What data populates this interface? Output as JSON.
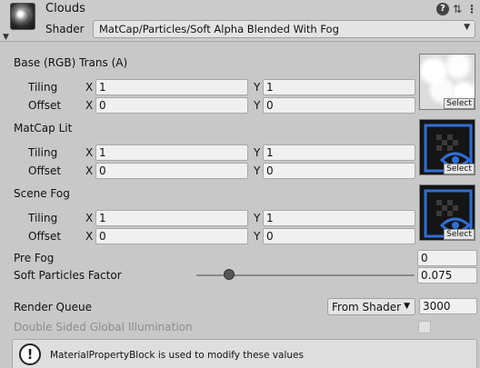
{
  "header": {
    "title": "Clouds",
    "shader_label": "Shader",
    "shader_value": "MatCap/Particles/Soft Alpha Blended With Fog",
    "icons": [
      "help-icon",
      "presets-icon",
      "more-icon"
    ]
  },
  "sections": [
    {
      "title": "Base (RGB) Trans (A)",
      "tiling_label": "Tiling",
      "offset_label": "Offset",
      "tiling_x": "1",
      "tiling_y": "1",
      "offset_x": "0",
      "offset_y": "0",
      "texture": "clouds",
      "select_label": "Select"
    },
    {
      "title": "MatCap Lit",
      "tiling_label": "Tiling",
      "offset_label": "Offset",
      "tiling_x": "1",
      "tiling_y": "1",
      "offset_x": "0",
      "offset_y": "0",
      "texture": "default-checker-eye",
      "select_label": "Select"
    },
    {
      "title": "Scene Fog",
      "tiling_label": "Tiling",
      "offset_label": "Offset",
      "tiling_x": "1",
      "tiling_y": "1",
      "offset_x": "0",
      "offset_y": "0",
      "texture": "default-checker-eye",
      "select_label": "Select"
    }
  ],
  "axis": {
    "x": "X",
    "y": "Y"
  },
  "pre_fog": {
    "label": "Pre Fog",
    "value": "0"
  },
  "soft_particles": {
    "label": "Soft Particles Factor",
    "value": "0.075",
    "slider_fraction": 0.15
  },
  "render_queue": {
    "label": "Render Queue",
    "mode": "From Shader",
    "value": "3000"
  },
  "double_sided_gi": {
    "label": "Double Sided Global Illumination",
    "checked": false
  },
  "helpbox": {
    "text": "MaterialPropertyBlock is used to modify these values"
  },
  "colors": {
    "panel_bg": "#c8c8c8",
    "field_bg": "#f0f0f0",
    "texture_accent": "#2f6fd6"
  }
}
